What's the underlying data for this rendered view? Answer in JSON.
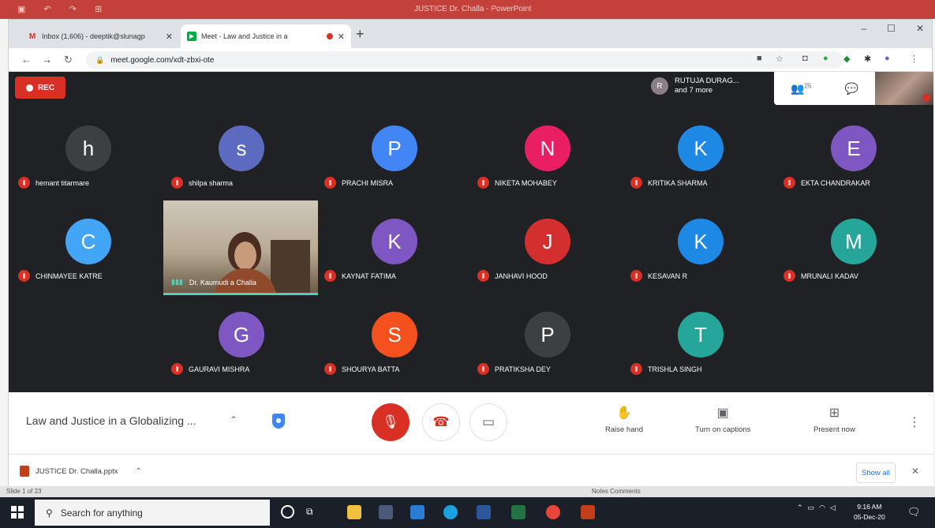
{
  "browser": {
    "tabs": [
      {
        "label": "Inbox (1,606) - deeptik@slunagp",
        "icon": "gmail-icon",
        "active": false
      },
      {
        "label": "Meet - Law and Justice in a",
        "icon": "meet-icon",
        "active": true
      }
    ],
    "url": "meet.google.com/xdt-zbxi-ote",
    "tab_close": "✕",
    "new_tab": "+",
    "window_controls": [
      "–",
      "☐",
      "✕"
    ]
  },
  "meet": {
    "rec_label": "REC",
    "presenter": {
      "initial": "R",
      "name": "RUTUJA DURAG...",
      "more": "and 7 more"
    },
    "participant_count": "25",
    "participants": [
      {
        "initial": "h",
        "name": "hemant titarmare",
        "color": "#3c4043"
      },
      {
        "initial": "s",
        "name": "shilpa sharma",
        "color": "#5c6bc0"
      },
      {
        "initial": "P",
        "name": "PRACHI MISRA",
        "color": "#4285f4"
      },
      {
        "initial": "N",
        "name": "NIKETA MOHABEY",
        "color": "#e91e63"
      },
      {
        "initial": "K",
        "name": "KRITIKA SHARMA",
        "color": "#1e88e5"
      },
      {
        "initial": "E",
        "name": "EKTA CHANDRAKAR",
        "color": "#7e57c2"
      },
      {
        "initial": "C",
        "name": "CHINMAYEE KATRE",
        "color": "#42a5f5"
      },
      {
        "initial": "K",
        "name": "KAYNAT FATIMA",
        "color": "#7e57c2"
      },
      {
        "initial": "J",
        "name": "JANHAVI HOOD",
        "color": "#d32f2f"
      },
      {
        "initial": "K",
        "name": "KESAVAN R",
        "color": "#1e88e5"
      },
      {
        "initial": "M",
        "name": "MRUNALI KADAV",
        "color": "#26a69a"
      },
      {
        "initial": "G",
        "name": "GAURAVI MISHRA",
        "color": "#7e57c2"
      },
      {
        "initial": "S",
        "name": "SHOURYA BATTA",
        "color": "#f4511e"
      },
      {
        "initial": "P",
        "name": "PRATIKSHA DEY",
        "color": "#3c4043"
      },
      {
        "initial": "T",
        "name": "TRISHLA SINGH",
        "color": "#26a69a"
      }
    ],
    "video_participant": "Dr. Kaumudi a Challa",
    "meeting_title": "Law and Justice in a Globalizing ...",
    "controls": {
      "raise_hand": "Raise hand",
      "captions": "Turn on captions",
      "present": "Present now"
    }
  },
  "download": {
    "file": "JUSTICE Dr. Challa.pptx",
    "show_all": "Show all"
  },
  "ppt_status": {
    "left": "Slide 1 of 23",
    "right": "Notes  Comments"
  },
  "taskbar": {
    "search_placeholder": "Search for anything",
    "time": "9:16 AM",
    "date": "05-Dec-20"
  },
  "colors": {
    "mic_muted": "#d93025",
    "meet_bg": "#202124",
    "accent": "#1a73e8"
  }
}
